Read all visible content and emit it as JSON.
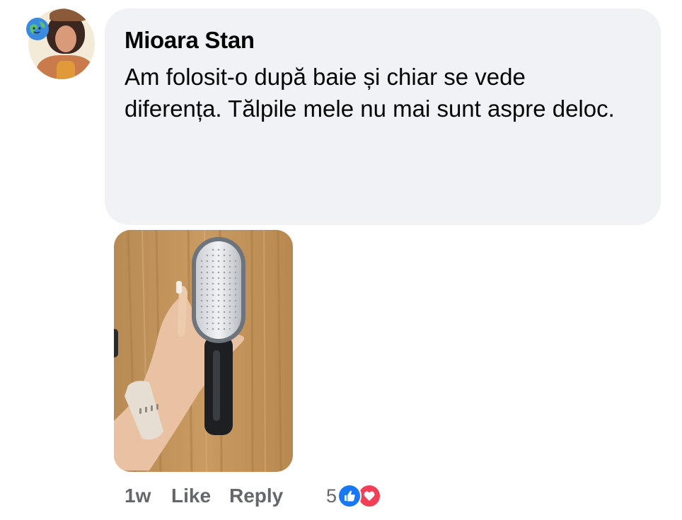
{
  "comment": {
    "author": "Mioara Stan",
    "text": "Am folosit-o după baie și chiar se vede diferența. Tălpile mele nu mai sunt aspre deloc.",
    "avatar_icon": "profile-photo",
    "attachment_description_icon": "photo-attachment"
  },
  "actions": {
    "time": "1w",
    "like_label": "Like",
    "reply_label": "Reply"
  },
  "reactions": {
    "count": "5",
    "types": [
      "like-icon",
      "love-icon"
    ],
    "like_color": "#1877f2",
    "love_color": "#f33e58"
  },
  "colors": {
    "bubble": "#f0f2f5",
    "text": "#050505",
    "secondary": "#65676b"
  }
}
